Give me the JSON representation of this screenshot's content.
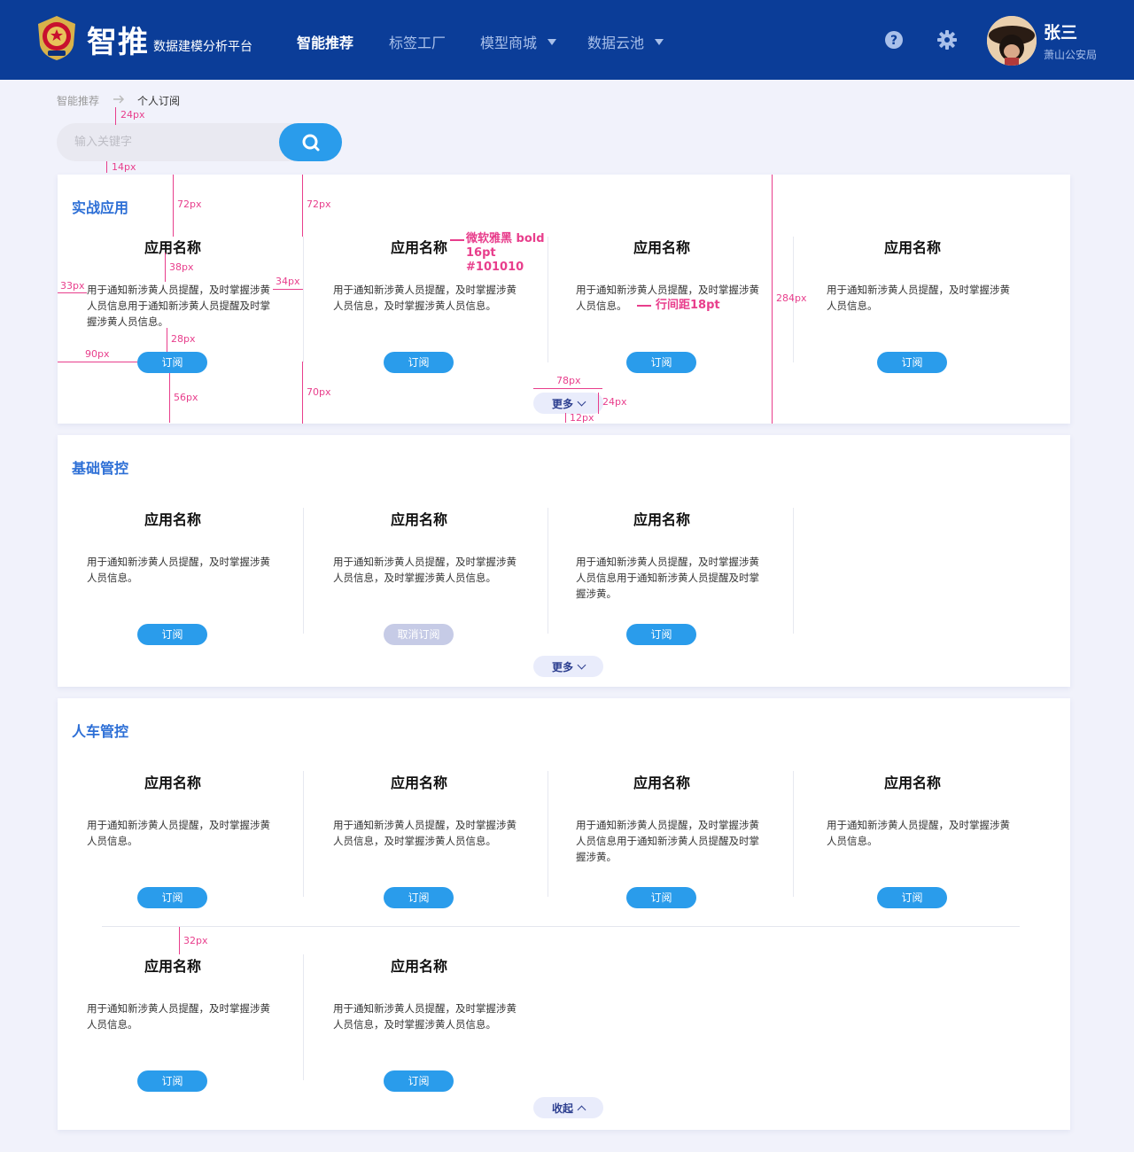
{
  "header": {
    "brand": "智推",
    "brand_sub": "数据建模分析平台",
    "nav": [
      {
        "label": "智能推荐",
        "active": true
      },
      {
        "label": "标签工厂",
        "active": false
      },
      {
        "label": "模型商城",
        "active": false,
        "dropdown": true
      },
      {
        "label": "数据云池",
        "active": false,
        "dropdown": true
      }
    ],
    "user": {
      "name": "张三",
      "dept": "萧山公安局"
    },
    "colors": {
      "bg": "#0b3d98",
      "accent": "#2a9ceb"
    }
  },
  "breadcrumb": {
    "home": "智能推荐",
    "current": "个人订阅"
  },
  "search": {
    "placeholder": "输入关键字"
  },
  "sections": [
    {
      "title": "实战应用",
      "cards": [
        {
          "name": "应用名称",
          "desc": "用于通知新涉黄人员提醒，及时掌握涉黄人员信息用于通知新涉黄人员提醒及时掌握涉黄人员信息。",
          "button": "订阅"
        },
        {
          "name": "应用名称",
          "desc": "用于通知新涉黄人员提醒，及时掌握涉黄人员信息，及时掌握涉黄人员信息。",
          "button": "订阅"
        },
        {
          "name": "应用名称",
          "desc": "用于通知新涉黄人员提醒，及时掌握涉黄人员信息。",
          "button": "订阅"
        },
        {
          "name": "应用名称",
          "desc": "用于通知新涉黄人员提醒，及时掌握涉黄人员信息。",
          "button": "订阅"
        }
      ],
      "toggle": "更多"
    },
    {
      "title": "基础管控",
      "cards": [
        {
          "name": "应用名称",
          "desc": "用于通知新涉黄人员提醒，及时掌握涉黄人员信息。",
          "button": "订阅"
        },
        {
          "name": "应用名称",
          "desc": "用于通知新涉黄人员提醒，及时掌握涉黄人员信息，及时掌握涉黄人员信息。",
          "button": "取消订阅"
        },
        {
          "name": "应用名称",
          "desc": "用于通知新涉黄人员提醒，及时掌握涉黄人员信息用于通知新涉黄人员提醒及时掌握涉黄。",
          "button": "订阅"
        }
      ],
      "toggle": "更多"
    },
    {
      "title": "人车管控",
      "cards": [
        {
          "name": "应用名称",
          "desc": "用于通知新涉黄人员提醒，及时掌握涉黄人员信息。",
          "button": "订阅"
        },
        {
          "name": "应用名称",
          "desc": "用于通知新涉黄人员提醒，及时掌握涉黄人员信息，及时掌握涉黄人员信息。",
          "button": "订阅"
        },
        {
          "name": "应用名称",
          "desc": "用于通知新涉黄人员提醒，及时掌握涉黄人员信息用于通知新涉黄人员提醒及时掌握涉黄。",
          "button": "订阅"
        },
        {
          "name": "应用名称",
          "desc": "用于通知新涉黄人员提醒，及时掌握涉黄人员信息。",
          "button": "订阅"
        },
        {
          "name": "应用名称",
          "desc": "用于通知新涉黄人员提醒，及时掌握涉黄人员信息。",
          "button": "订阅"
        },
        {
          "name": "应用名称",
          "desc": "用于通知新涉黄人员提醒，及时掌握涉黄人员信息，及时掌握涉黄人员信息。",
          "button": "订阅"
        }
      ],
      "toggle": "收起"
    }
  ],
  "annotations": {
    "a24": "24px",
    "a14": "14px",
    "a72a": "72px",
    "a72b": "72px",
    "a38": "38px",
    "a33": "33px",
    "a34": "34px",
    "a28": "28px",
    "a90": "90px",
    "a56": "56px",
    "a70": "70px",
    "a78": "78px",
    "a24b": "24px",
    "a12": "12px",
    "a284": "284px",
    "a32": "32px",
    "font_note": [
      "微软雅黑 bold",
      "16pt",
      "#101010"
    ],
    "line_note": "行间距18pt",
    "color": "#e83e8c"
  }
}
